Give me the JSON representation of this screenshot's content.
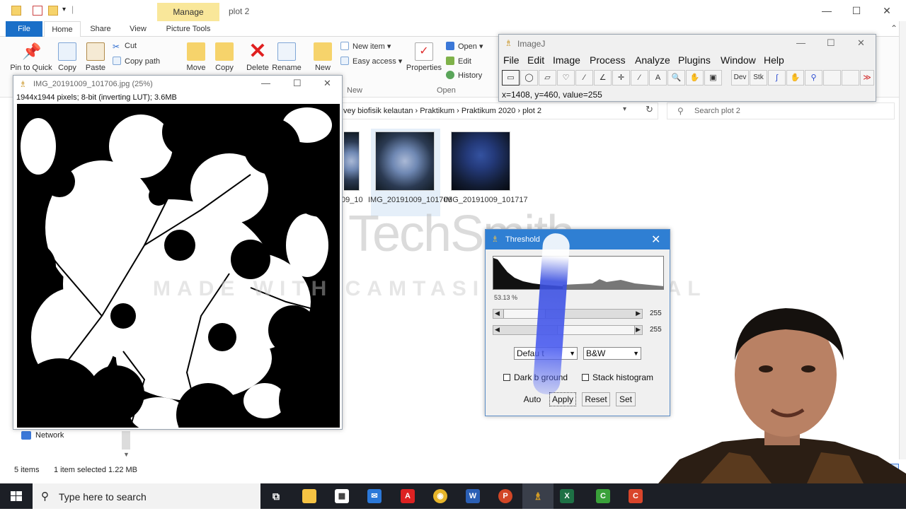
{
  "colors": {
    "file_tab": "#1a6fc8",
    "manage_tab": "#f9e79a",
    "threshold_titlebar": "#2f7fd3",
    "taskbar": "#1c1f26",
    "delete_red": "#e02020"
  },
  "explorer": {
    "window_title": "plot 2",
    "manage_tab": "Manage",
    "picture_tools_tab": "Picture Tools",
    "tabs": [
      "File",
      "Home",
      "Share",
      "View"
    ],
    "ribbon": {
      "pin_label": "Pin to Quick",
      "copy_label": "Copy",
      "paste_label": "Paste",
      "cut_label": "Cut",
      "copy_path_label": "Copy path",
      "move_label": "Move",
      "copy_to_label": "Copy",
      "delete_label": "Delete",
      "rename_label": "Rename",
      "new_folder_label": "New",
      "new_item_label": "New item",
      "easy_access_label": "Easy access",
      "new_group_label": "New",
      "properties_label": "Properties",
      "open_label": "Open",
      "edit_label": "Edit",
      "history_label": "History",
      "open_group_label": "Open"
    },
    "address": {
      "breadcrumb": "vey biofisik kelautan  ›  Praktikum  ›  Praktikum 2020  ›  plot 2",
      "dropdown_icon": "▾",
      "refresh_icon": "↻"
    },
    "search_placeholder": "Search plot 2",
    "files": [
      {
        "label": "09_10"
      },
      {
        "label": "IMG_20191009_101706"
      },
      {
        "label": "IMG_20191009_101717"
      }
    ],
    "nav_network": "Network",
    "status_items": "5 items",
    "status_selected": "1 item selected  1.22 MB"
  },
  "imagej_image": {
    "title": "IMG_20191009_101706.jpg (25%)",
    "info": "1944x1944 pixels; 8-bit (inverting LUT); 3.6MB"
  },
  "imagej": {
    "title": "ImageJ",
    "menu": [
      "File",
      "Edit",
      "Image",
      "Process",
      "Analyze",
      "Plugins",
      "Window",
      "Help"
    ],
    "tools": [
      "▭",
      "◯",
      "▱",
      "♡",
      "∕",
      "∠",
      "✛",
      "⁄",
      "A",
      "🔍",
      "✋",
      "▣",
      "Dev",
      "Stk",
      "∫",
      "✋",
      "⚲",
      "",
      "",
      "≫"
    ],
    "status": "x=1408, y=460, value=255"
  },
  "threshold": {
    "title": "Threshold",
    "percent": "53.13 %",
    "slider_min_value": "255",
    "slider_max_value": "255",
    "method": "Defau t",
    "mode": "B&W",
    "dark_background": "Dark b    ground",
    "stack_histogram": "Stack histogram",
    "auto": "Auto",
    "apply": "Apply",
    "reset": "Reset",
    "set": "Set"
  },
  "watermark": {
    "brand": "TechSmith",
    "text": "MADE WITH CAMTASIA FREE TRIAL"
  },
  "taskbar": {
    "search_placeholder": "Type here to search",
    "apps": [
      "Task View",
      "File Explorer",
      "Store",
      "Mail",
      "Acrobat",
      "Chrome",
      "Word",
      "PowerPoint",
      "ImageJ",
      "Excel",
      "Camtasia",
      "Recorder"
    ]
  }
}
